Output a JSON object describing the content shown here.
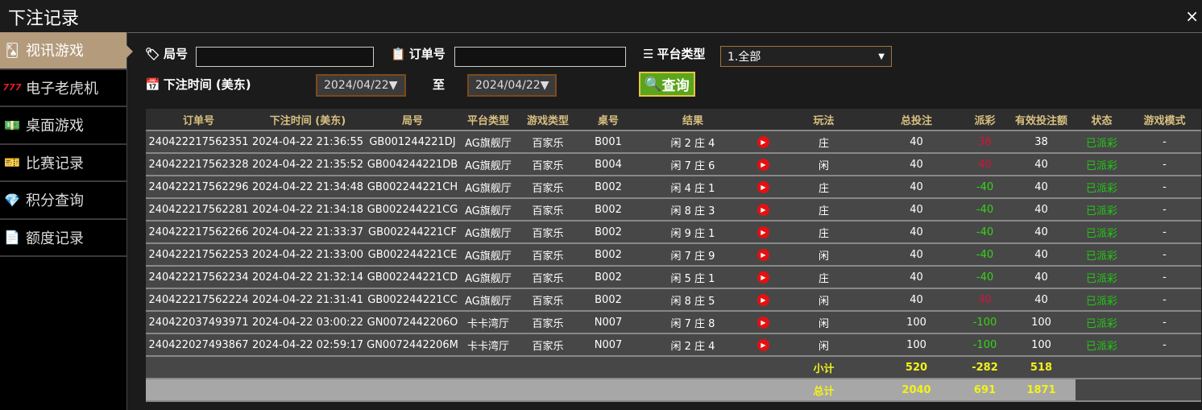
{
  "window": {
    "title": "下注记录",
    "close": "×"
  },
  "sidebar": [
    {
      "icon": "🂮",
      "label": "视讯游戏",
      "name": "cards"
    },
    {
      "icon": "777",
      "label": "电子老虎机",
      "name": "slot"
    },
    {
      "icon": "💵",
      "label": "桌面游戏",
      "name": "money"
    },
    {
      "icon": "🎫",
      "label": "比赛记录",
      "name": "ticket"
    },
    {
      "icon": "💎",
      "label": "积分查询",
      "name": "diamond"
    },
    {
      "icon": "📄",
      "label": "额度记录",
      "name": "document"
    }
  ],
  "filters": {
    "round_label": "局号",
    "round_value": "",
    "order_label": "订单号",
    "order_value": "",
    "platform_label": "平台类型",
    "platform_value": "1.全部",
    "time_label": "下注时间 (美东)",
    "date_from": "2024/04/22▼",
    "to_label": "至",
    "date_to": "2024/04/22▼",
    "query": "查询"
  },
  "table": {
    "headers": [
      "订单号",
      "下注时间 (美东)",
      "局号",
      "平台类型",
      "游戏类型",
      "桌号",
      "结果",
      "",
      "玩法",
      "总投注",
      "派彩",
      "有效投注额",
      "状态",
      "游戏模式"
    ],
    "rows": [
      [
        "240422217562351",
        "2024-04-22 21:36:55",
        "GB001244221DJ",
        "AG旗舰厅",
        "百家乐",
        "B001",
        "闲 2 庄 4",
        "庄",
        "40",
        "38",
        "38",
        "已派彩",
        "-"
      ],
      [
        "240422217562328",
        "2024-04-22 21:35:52",
        "GB004244221DB",
        "AG旗舰厅",
        "百家乐",
        "B004",
        "闲 7 庄 6",
        "闲",
        "40",
        "40",
        "40",
        "已派彩",
        "-"
      ],
      [
        "240422217562296",
        "2024-04-22 21:34:48",
        "GB002244221CH",
        "AG旗舰厅",
        "百家乐",
        "B002",
        "闲 4 庄 1",
        "庄",
        "40",
        "-40",
        "40",
        "已派彩",
        "-"
      ],
      [
        "240422217562281",
        "2024-04-22 21:34:18",
        "GB002244221CG",
        "AG旗舰厅",
        "百家乐",
        "B002",
        "闲 8 庄 3",
        "庄",
        "40",
        "-40",
        "40",
        "已派彩",
        "-"
      ],
      [
        "240422217562266",
        "2024-04-22 21:33:37",
        "GB002244221CF",
        "AG旗舰厅",
        "百家乐",
        "B002",
        "闲 9 庄 1",
        "庄",
        "40",
        "-40",
        "40",
        "已派彩",
        "-"
      ],
      [
        "240422217562253",
        "2024-04-22 21:33:00",
        "GB002244221CE",
        "AG旗舰厅",
        "百家乐",
        "B002",
        "闲 7 庄 9",
        "闲",
        "40",
        "-40",
        "40",
        "已派彩",
        "-"
      ],
      [
        "240422217562234",
        "2024-04-22 21:32:14",
        "GB002244221CD",
        "AG旗舰厅",
        "百家乐",
        "B002",
        "闲 5 庄 1",
        "庄",
        "40",
        "-40",
        "40",
        "已派彩",
        "-"
      ],
      [
        "240422217562224",
        "2024-04-22 21:31:41",
        "GB002244221CC",
        "AG旗舰厅",
        "百家乐",
        "B002",
        "闲 8 庄 5",
        "闲",
        "40",
        "40",
        "40",
        "已派彩",
        "-"
      ],
      [
        "240422037493971",
        "2024-04-22 03:00:22",
        "GN0072442206O",
        "卡卡湾厅",
        "百家乐",
        "N007",
        "闲 7 庄 8",
        "闲",
        "100",
        "-100",
        "100",
        "已派彩",
        "-"
      ],
      [
        "240422027493867",
        "2024-04-22 02:59:17",
        "GN0072442206M",
        "卡卡湾厅",
        "百家乐",
        "N007",
        "闲 2 庄 4",
        "闲",
        "100",
        "-100",
        "100",
        "已派彩",
        "-"
      ]
    ],
    "subtotal": {
      "label": "小计",
      "bet": "520",
      "payout": "-282",
      "valid": "518"
    },
    "total": {
      "label": "总计",
      "bet": "2040",
      "payout": "691",
      "valid": "1871"
    }
  },
  "colors": {
    "positive": "#d4143a",
    "negative": "#36d416",
    "status": "#22c814"
  }
}
